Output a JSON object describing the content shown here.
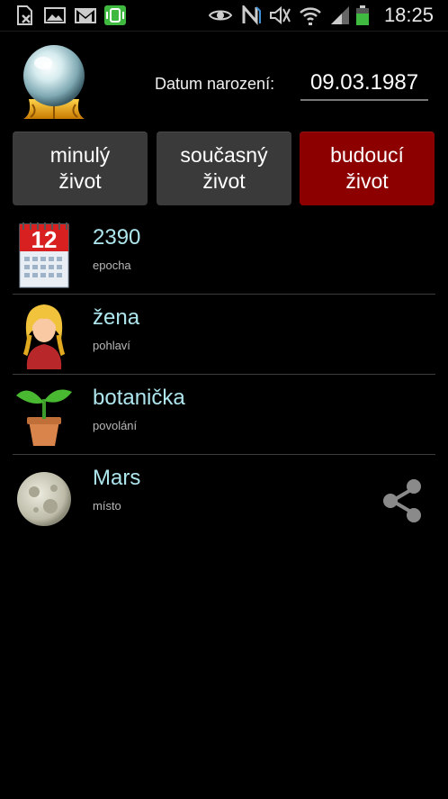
{
  "status_bar": {
    "time": "18:25",
    "icons": [
      "document-x-icon",
      "image-icon",
      "gmail-icon",
      "phone-vibrate-icon",
      "eye-icon",
      "nfc-icon",
      "mute-icon",
      "wifi-icon",
      "signal-icon",
      "battery-icon"
    ],
    "battery_color": "#3fb93f"
  },
  "header": {
    "dob_label": "Datum narození:",
    "dob_value": "09.03.1987"
  },
  "tabs": [
    {
      "label": "minulý\nživot",
      "active": false
    },
    {
      "label": "současný\nživot",
      "active": false
    },
    {
      "label": "budoucí\nživot",
      "active": true
    }
  ],
  "colors": {
    "active_tab": "#8c0000",
    "inactive_tab": "#3a3a3a",
    "title_text": "#aee6ee"
  },
  "items": [
    {
      "title": "2390",
      "subtitle": "epocha",
      "icon": "calendar-icon"
    },
    {
      "title": "žena",
      "subtitle": "pohlaví",
      "icon": "woman-avatar-icon"
    },
    {
      "title": "botanička",
      "subtitle": "povolání",
      "icon": "plant-pot-icon"
    },
    {
      "title": "Mars",
      "subtitle": "místo",
      "icon": "moon-planet-icon"
    }
  ],
  "share_icon": "share-icon"
}
